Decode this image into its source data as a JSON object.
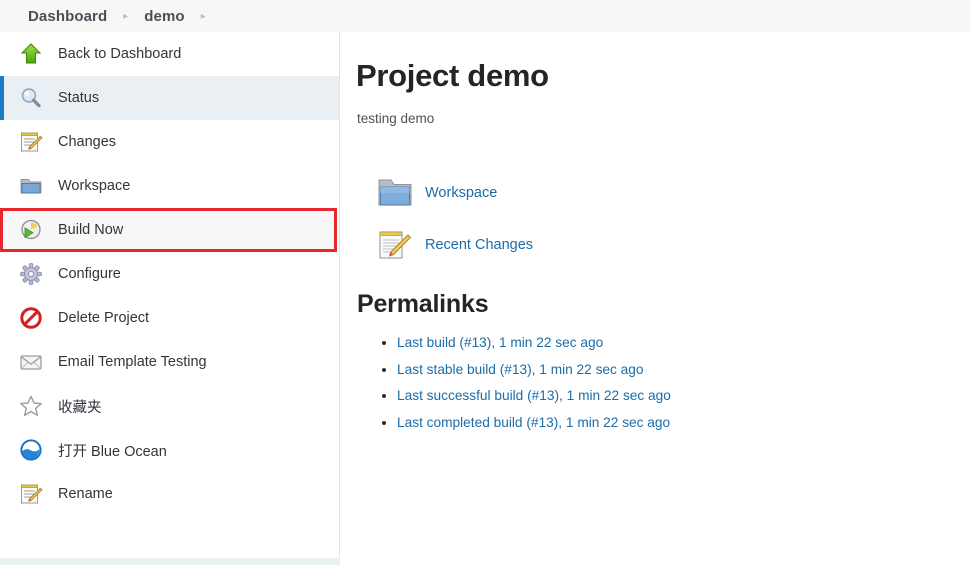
{
  "breadcrumb": {
    "items": [
      {
        "label": "Dashboard"
      },
      {
        "label": "demo"
      }
    ],
    "separator": "▸"
  },
  "sidebar": {
    "items": [
      {
        "label": "Back to Dashboard",
        "icon": "up-arrow-green-icon",
        "state": "normal"
      },
      {
        "label": "Status",
        "icon": "magnifier-icon",
        "state": "active"
      },
      {
        "label": "Changes",
        "icon": "notepad-pencil-icon",
        "state": "normal"
      },
      {
        "label": "Workspace",
        "icon": "folder-icon",
        "state": "normal"
      },
      {
        "label": "Build Now",
        "icon": "clock-play-icon",
        "state": "highlight"
      },
      {
        "label": "Configure",
        "icon": "gear-icon",
        "state": "normal"
      },
      {
        "label": "Delete Project",
        "icon": "no-entry-icon",
        "state": "normal"
      },
      {
        "label": "Email Template Testing",
        "icon": "envelope-icon",
        "state": "normal"
      },
      {
        "label": "收藏夹",
        "icon": "star-outline-icon",
        "state": "normal"
      },
      {
        "label": "打开 Blue Ocean",
        "icon": "blue-ocean-icon",
        "state": "normal"
      },
      {
        "label": "Rename",
        "icon": "notepad-pencil-icon",
        "state": "normal"
      }
    ]
  },
  "main": {
    "title": "Project demo",
    "description": "testing demo",
    "shortcuts": [
      {
        "label": "Workspace",
        "icon": "folder-icon"
      },
      {
        "label": "Recent Changes",
        "icon": "notepad-pencil-icon"
      }
    ],
    "permalinks_heading": "Permalinks",
    "permalinks": [
      {
        "label": "Last build (#13), 1 min 22 sec ago"
      },
      {
        "label": "Last stable build (#13), 1 min 22 sec ago"
      },
      {
        "label": "Last successful build (#13), 1 min 22 sec ago"
      },
      {
        "label": "Last completed build (#13), 1 min 22 sec ago"
      }
    ]
  },
  "colors": {
    "link": "#1b6ca8",
    "accent": "#1b7cc4",
    "highlight_border": "#e8262d",
    "topbar_bg": "#f7f7f7"
  }
}
